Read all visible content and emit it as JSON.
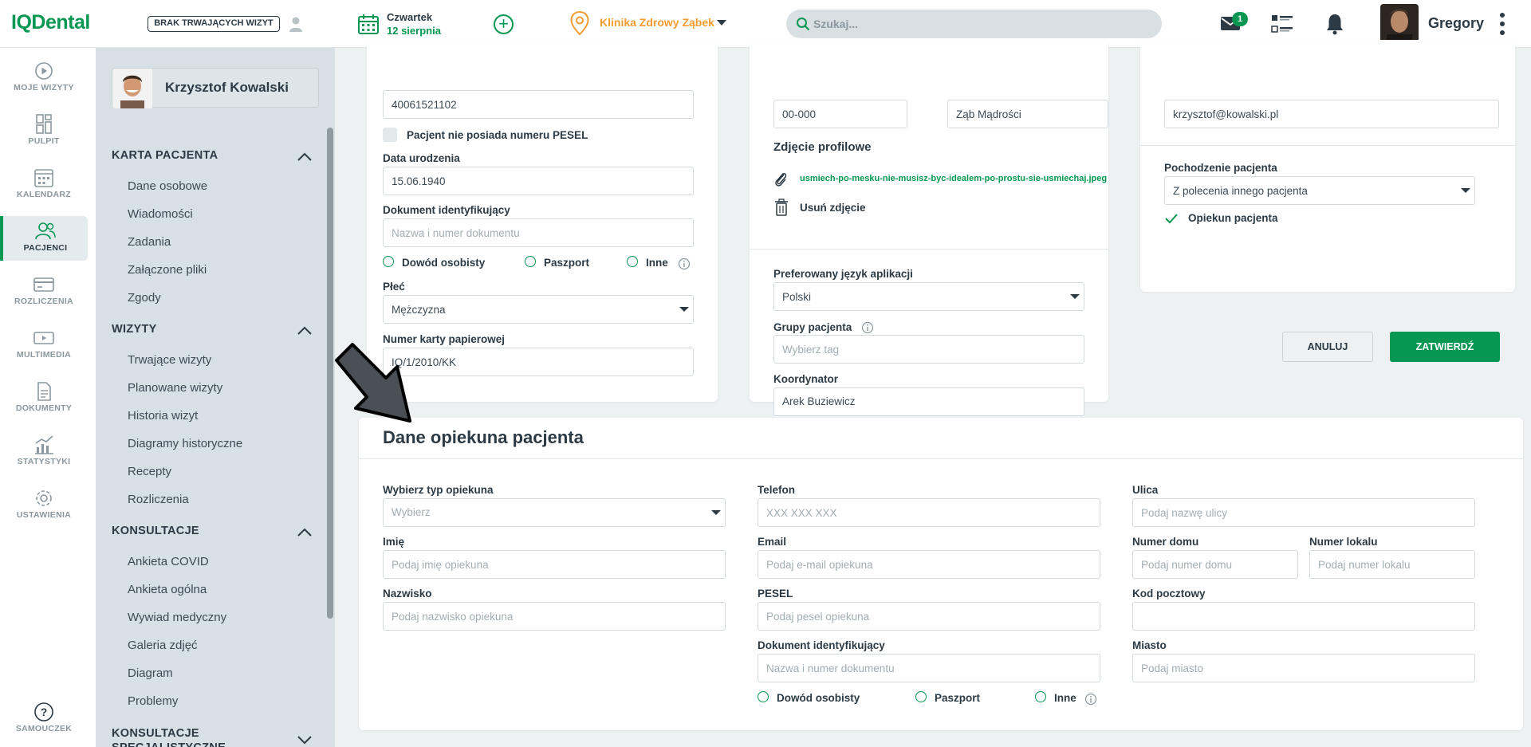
{
  "app": {
    "logo": "IQDental"
  },
  "topbar": {
    "no_visits_label": "BRAK TRWAJĄCYCH WIZYT",
    "day": "Czwartek",
    "date": "12 sierpnia",
    "clinic": "Klinika Zdrowy Ząbek",
    "search_placeholder": "Szukaj...",
    "mail_badge": "1",
    "user_name": "Gregory"
  },
  "rail": [
    {
      "label": "MOJE WIZYTY",
      "icon": "play-circle-icon"
    },
    {
      "label": "PULPIT",
      "icon": "dashboard-icon"
    },
    {
      "label": "KALENDARZ",
      "icon": "calendar-icon"
    },
    {
      "label": "PACJENCI",
      "icon": "patients-icon",
      "active": true
    },
    {
      "label": "ROZLICZENIA",
      "icon": "credit-card-icon"
    },
    {
      "label": "MULTIMEDIA",
      "icon": "multimedia-icon"
    },
    {
      "label": "DOKUMENTY",
      "icon": "document-icon"
    },
    {
      "label": "STATYSTYKI",
      "icon": "statistics-icon"
    },
    {
      "label": "USTAWIENIA",
      "icon": "gear-icon"
    },
    {
      "label": "SAMOUCZEK",
      "icon": "help-icon"
    }
  ],
  "sidebar": {
    "patient_name": "Krzysztof Kowalski",
    "sections": [
      {
        "title": "KARTA PACJENTA",
        "items": [
          "Dane osobowe",
          "Wiadomości",
          "Zadania",
          "Załączone pliki",
          "Zgody"
        ]
      },
      {
        "title": "WIZYTY",
        "items": [
          "Trwające wizyty",
          "Planowane wizyty",
          "Historia wizyt",
          "Diagramy historyczne",
          "Recepty",
          "Rozliczenia"
        ]
      },
      {
        "title": "KONSULTACJE",
        "items": [
          "Ankieta COVID",
          "Ankieta ogólna",
          "Wywiad medyczny",
          "Galeria zdjęć",
          "Diagram",
          "Problemy"
        ]
      },
      {
        "title": "KONSULTACJE SPECJALISTYCZNE",
        "items": []
      }
    ]
  },
  "form1": {
    "pesel_value": "40061521102",
    "no_pesel_label": "Pacjent nie posiada numeru PESEL",
    "birth_label": "Data urodzenia",
    "birth_value": "15.06.1940",
    "doc_label": "Dokument identyfikujący",
    "doc_placeholder": "Nazwa i numer dokumentu",
    "radio_id": "Dowód osobisty",
    "radio_passport": "Paszport",
    "radio_other": "Inne",
    "gender_label": "Płeć",
    "gender_value": "Mężczyzna",
    "card_label": "Numer karty papierowej",
    "card_value": "IQ/1/2010/KK"
  },
  "form2": {
    "postal_value": "00-000",
    "city_value": "Ząb Mądrości",
    "photo_label": "Zdjęcie profilowe",
    "photo_file": "usmiech-po-mesku-nie-musisz-byc-idealem-po-prostu-sie-usmiechaj.jpeg",
    "remove_photo": "Usuń zdjęcie",
    "lang_label": "Preferowany język aplikacji",
    "lang_value": "Polski",
    "groups_label": "Grupy pacjenta",
    "groups_placeholder": "Wybierz tag",
    "coord_label": "Koordynator",
    "coord_value": "Arek Buziewicz"
  },
  "form3": {
    "email_value": "krzysztof@kowalski.pl",
    "origin_label": "Pochodzenie pacjenta",
    "origin_value": "Z polecenia innego pacjenta",
    "guardian_label": "Opiekun pacjenta"
  },
  "actions": {
    "cancel": "ANULUJ",
    "confirm": "ZATWIERDŹ"
  },
  "guardian": {
    "title": "Dane opiekuna pacjenta",
    "type_label": "Wybierz typ opiekuna",
    "type_placeholder": "Wybierz",
    "first_label": "Imię",
    "first_placeholder": "Podaj imię opiekuna",
    "last_label": "Nazwisko",
    "last_placeholder": "Podaj nazwisko opiekuna",
    "phone_label": "Telefon",
    "phone_placeholder": "XXX XXX XXX",
    "email_label": "Email",
    "email_placeholder": "Podaj e-mail opiekuna",
    "pesel_label": "PESEL",
    "pesel_placeholder": "Podaj pesel opiekuna",
    "doc_label": "Dokument identyfikujący",
    "doc_placeholder": "Nazwa i numer dokumentu",
    "radio_id": "Dowód osobisty",
    "radio_passport": "Paszport",
    "radio_other": "Inne",
    "street_label": "Ulica",
    "street_placeholder": "Podaj nazwę ulicy",
    "house_label": "Numer domu",
    "house_placeholder": "Podaj numer domu",
    "flat_label": "Numer lokalu",
    "flat_placeholder": "Podaj numer lokalu",
    "postal_label": "Kod pocztowy",
    "postal_placeholder": "",
    "city_label": "Miasto",
    "city_placeholder": "Podaj miasto"
  },
  "colors": {
    "brand": "#079752",
    "accent_orange": "#f39a32",
    "text": "#2b3a44"
  }
}
